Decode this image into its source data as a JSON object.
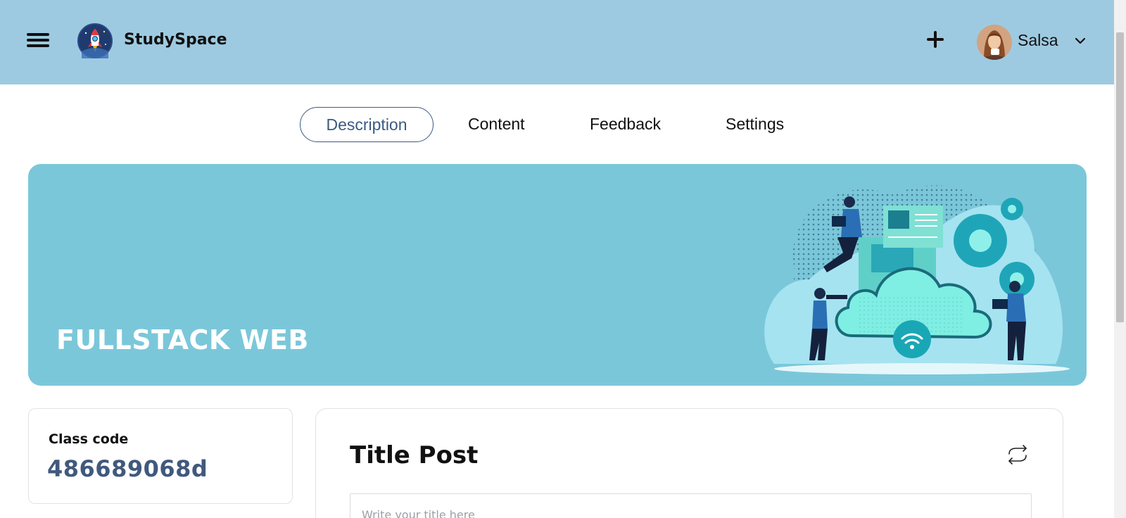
{
  "header": {
    "brand": "StudySpace",
    "user_name": "Salsa"
  },
  "tabs": [
    {
      "label": "Description",
      "active": true
    },
    {
      "label": "Content",
      "active": false
    },
    {
      "label": "Feedback",
      "active": false
    },
    {
      "label": "Settings",
      "active": false
    }
  ],
  "banner": {
    "title": "FULLSTACK WEB"
  },
  "class_info": {
    "label": "Class code",
    "code": "486689068d"
  },
  "post": {
    "title": "Title Post",
    "input_placeholder": "Write your title here"
  },
  "icons": {
    "menu": "hamburger-menu-icon",
    "logo": "rocket-logo-icon",
    "add": "plus-icon",
    "dropdown": "chevron-down-icon",
    "refresh": "refresh-icon"
  },
  "colors": {
    "header_bg": "#9ecae1",
    "banner_bg": "#7bc7da",
    "accent": "#3c5a80",
    "code_color": "#40597d"
  }
}
